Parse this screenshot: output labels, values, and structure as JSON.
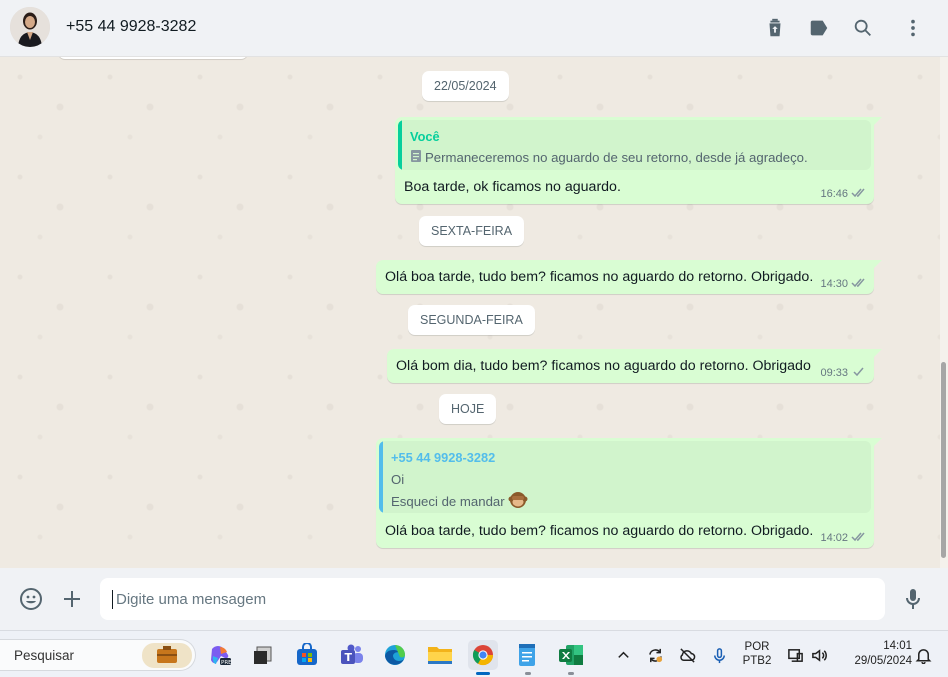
{
  "header": {
    "contact_name": "+55 44 9928-3282",
    "icons": [
      "trash-icon",
      "label-icon",
      "search-icon",
      "menu-icon"
    ]
  },
  "chat": {
    "date_chips": [
      "22/05/2024",
      "SEXTA-FEIRA",
      "SEGUNDA-FEIRA",
      "HOJE"
    ],
    "msg1": {
      "quote_author": "Você",
      "quote_text": "Permaneceremos no aguardo de seu retorno, desde já agradeço.",
      "text": "Boa tarde, ok ficamos no aguardo.",
      "time": "16:46"
    },
    "msg2": {
      "text": "Olá boa tarde, tudo bem? ficamos no aguardo do retorno. Obrigado.",
      "time": "14:30"
    },
    "msg3": {
      "text": "Olá bom dia, tudo bem? ficamos no aguardo do retorno. Obrigado",
      "time": "09:33"
    },
    "msg4": {
      "quote_author": "+55 44 9928-3282",
      "quote_line1": "Oi",
      "quote_line2": "Esqueci de mandar",
      "text": "Olá boa tarde, tudo bem? ficamos no aguardo do retorno. Obrigado.",
      "time": "14:02"
    },
    "colors": {
      "outgoing_bubble": "#d9fdd3",
      "quote_self": "#06cf9c",
      "quote_contact": "#53bdeb",
      "background": "#efeae2"
    }
  },
  "composer": {
    "placeholder": "Digite uma mensagem",
    "icons": [
      "emoji-icon",
      "plus-icon",
      "microphone-icon"
    ]
  },
  "taskbar": {
    "search_label": "Pesquisar",
    "apps": [
      "copilot-icon",
      "app-icon",
      "store-icon",
      "teams-icon",
      "edge-icon",
      "file-explorer-icon",
      "chrome-icon",
      "notepad-icon",
      "excel-icon"
    ],
    "lang_top": "POR",
    "lang_bottom": "PTB2",
    "time": "14:01",
    "date": "29/05/2024"
  }
}
